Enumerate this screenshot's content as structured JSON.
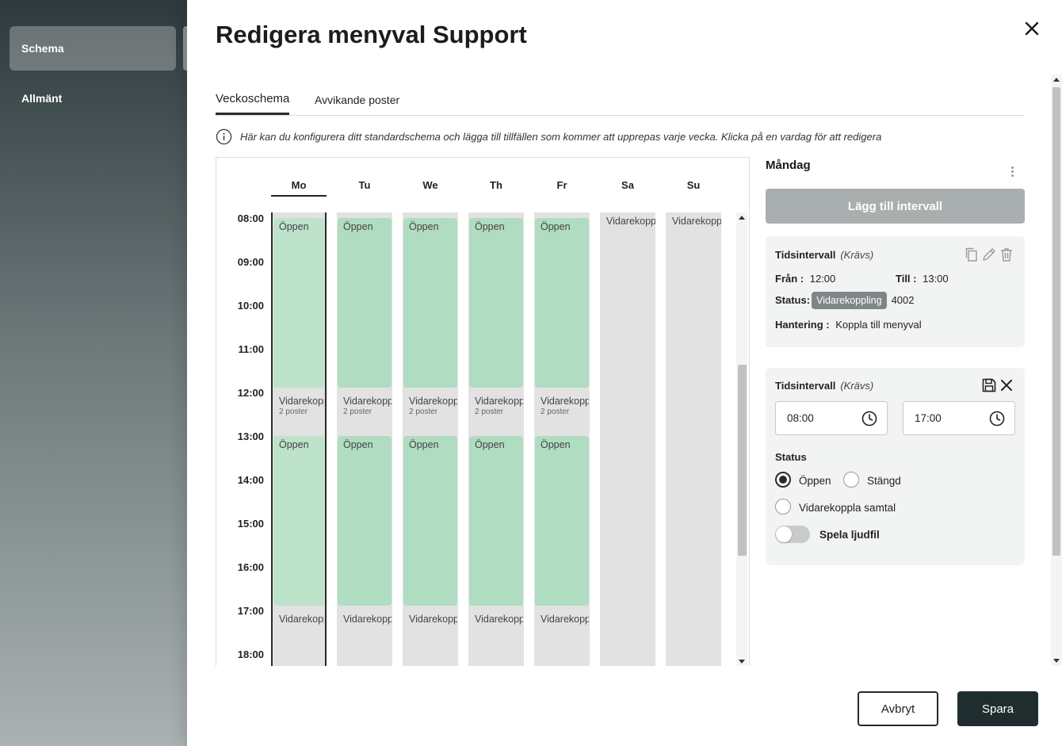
{
  "nav": {
    "items": [
      {
        "label": "Schema",
        "active": true
      },
      {
        "label": "Allmänt",
        "active": false
      }
    ]
  },
  "drawer": {
    "title": "Redigera menyval Support"
  },
  "tabs": [
    {
      "label": "Veckoschema",
      "active": true
    },
    {
      "label": "Avvikande poster",
      "active": false
    }
  ],
  "info_text": "Här kan du konfigurera ditt standardschema och lägga till tillfällen som kommer att upprepas varje vecka. Klicka på en vardag för att redigera",
  "calendar": {
    "days": [
      "Mo",
      "Tu",
      "We",
      "Th",
      "Fr",
      "Sa",
      "Su"
    ],
    "selected_day": "Mo",
    "times": [
      "08:00",
      "09:00",
      "10:00",
      "11:00",
      "12:00",
      "13:00",
      "14:00",
      "15:00",
      "16:00",
      "17:00",
      "18:00"
    ],
    "open_label": "Öppen",
    "forward_label": "Vidarekoppling",
    "posts_label": "2 poster"
  },
  "panel": {
    "day_title": "Måndag",
    "add_interval_label": "Lägg till intervall",
    "card1": {
      "title": "Tidsintervall",
      "required": "(Krävs)",
      "from_label": "Från",
      "from_value": "12:00",
      "to_label": "Till",
      "to_value": "13:00",
      "status_label": "Status",
      "status_badge": "Vidarekoppling",
      "status_number": "4002",
      "handling_label": "Hantering",
      "handling_value": "Koppla till menyval"
    },
    "card2": {
      "title": "Tidsintervall",
      "required": "(Krävs)",
      "from_value": "08:00",
      "to_value": "17:00",
      "status_heading": "Status",
      "radio_open": "Öppen",
      "radio_closed": "Stängd",
      "radio_forward": "Vidarekoppla samtal",
      "selected": "Öppen",
      "toggle_label": "Spela ljudfil",
      "toggle_on": false
    }
  },
  "footer": {
    "cancel_label": "Avbryt",
    "save_label": "Spara"
  },
  "colors": {
    "open_green": "#b0dcc1",
    "forward_grey": "#e2e2e2",
    "primary_dark": "#1f2d2f"
  }
}
